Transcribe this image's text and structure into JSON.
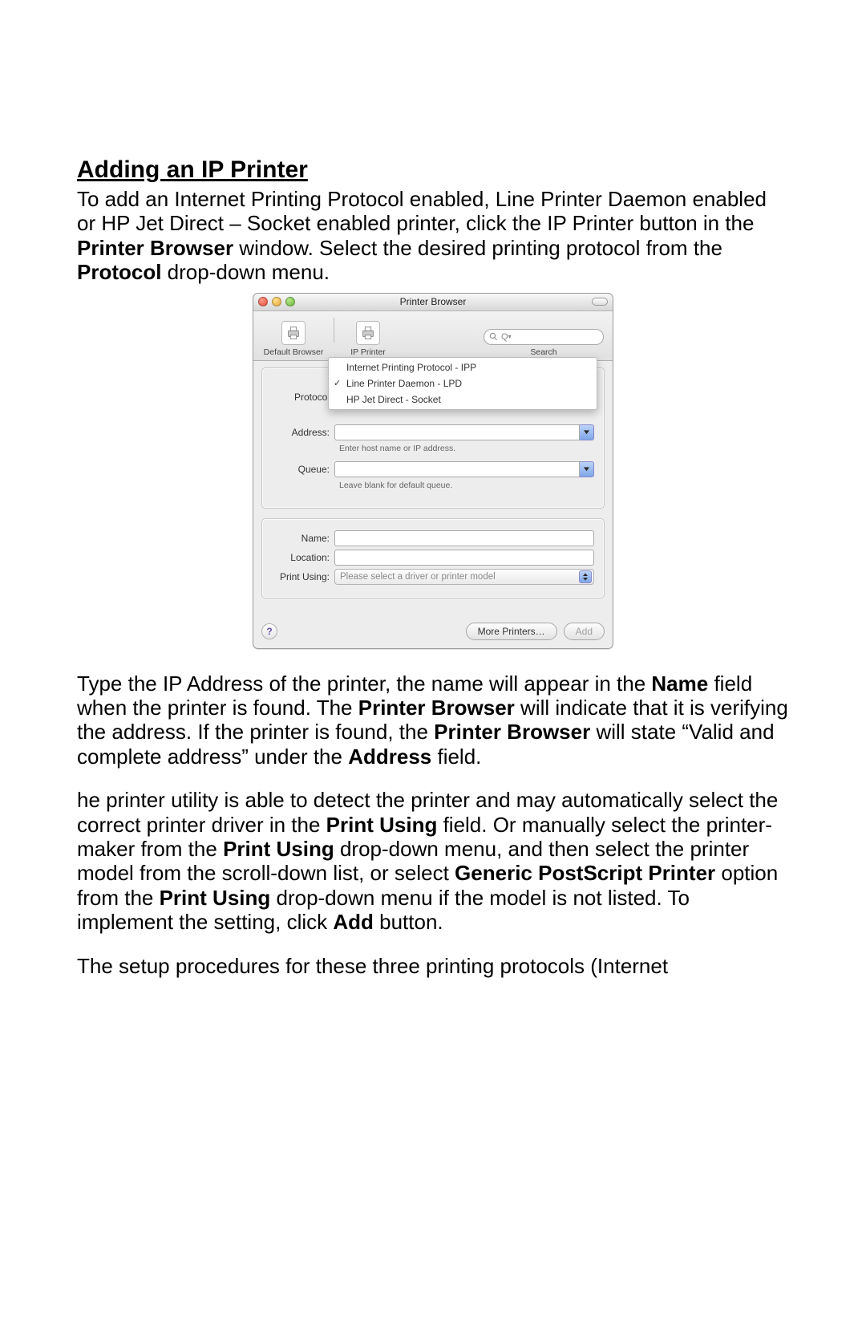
{
  "doc": {
    "heading": "Adding an IP Printer",
    "p1": "To add an Internet Printing Protocol enabled, Line Printer Daemon enabled or HP Jet Direct – Socket enabled printer, click the IP Printer button in the ",
    "p1b1": "Printer Browser",
    "p1m": " window. Select the desired printing protocol from the ",
    "p1b2": "Protocol",
    "p1e": " drop-down menu.",
    "p2a": "Type the IP Address of the printer, the name will appear in the ",
    "p2b1": "Name",
    "p2b": " field when the printer is found. The ",
    "p2b2": "Printer Browser",
    "p2c": " will indicate that it is verifying the address. If the printer is found, the ",
    "p2b3": "Printer Browser",
    "p2d": " will state “Valid and complete address” under the ",
    "p2b4": "Address",
    "p2e": " field.",
    "p3a": "he printer utility is able to detect the printer and may automatically select the correct printer driver in the ",
    "p3b1": "Print Using",
    "p3b": " field. Or manually select the printer-maker from the ",
    "p3b2": "Print Using",
    "p3c": " drop-down menu, and then select the printer model from the scroll-down list, or select ",
    "p3b3": "Generic PostScript Printer",
    "p3d": " option from the ",
    "p3b4": "Print Using",
    "p3e": " drop-down menu if the model is not listed. To implement the setting, click ",
    "p3b5": "Add",
    "p3f": " button.",
    "p4": "The setup procedures for these three printing protocols (Internet"
  },
  "window": {
    "title": "Printer Browser",
    "toolbar": {
      "default_browser": "Default Browser",
      "ip_printer": "IP Printer",
      "search_label": "Search",
      "search_prefix": "Q"
    },
    "protocol": {
      "label": "Protocol",
      "options": [
        "Internet Printing Protocol - IPP",
        "Line Printer Daemon - LPD",
        "HP Jet Direct - Socket"
      ],
      "selected_index": 1
    },
    "address": {
      "label": "Address:",
      "hint": "Enter host name or IP address."
    },
    "queue": {
      "label": "Queue:",
      "hint": "Leave blank for default queue."
    },
    "name": {
      "label": "Name:"
    },
    "location": {
      "label": "Location:"
    },
    "print_using": {
      "label": "Print Using:",
      "placeholder": "Please select a driver or printer model"
    },
    "footer": {
      "help": "?",
      "more_printers": "More Printers…",
      "add": "Add"
    }
  }
}
